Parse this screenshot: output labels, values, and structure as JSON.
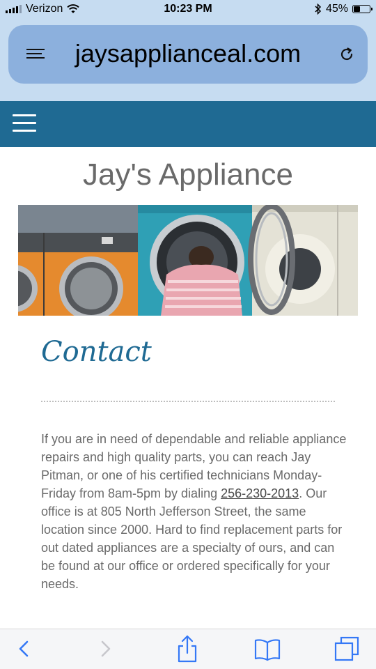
{
  "status_bar": {
    "carrier": "Verizon",
    "time": "10:23 PM",
    "battery_percent": "45%",
    "battery_level": 0.45
  },
  "browser": {
    "url": "jaysapplianceal.com",
    "reader_icon": "reader-lines-icon",
    "reload_icon": "reload-icon"
  },
  "site": {
    "nav_icon": "hamburger-menu-icon",
    "title": "Jay's Appliance",
    "banner_image": "laundromat washers banner",
    "heading": "Contact",
    "body_part1": "If you are in need of dependable and reliable appliance repairs and high quality parts, you can reach Jay Pitman, or one of his certified technicians Monday-Friday from 8am-5pm by dialing ",
    "phone": "256-230-2013",
    "body_part2": ". Our office is at 805 North Jefferson Street, the same location since 2000. Hard to find replacement parts for out dated appliances are a specialty of ours, and can be found at our office or ordered specifically for your needs."
  },
  "toolbar": {
    "back_icon": "back-chevron-icon",
    "forward_icon": "forward-chevron-icon",
    "share_icon": "share-icon",
    "bookmarks_icon": "bookmarks-book-icon",
    "tabs_icon": "tabs-icon"
  },
  "colors": {
    "chrome_bg": "#c6dcf1",
    "address_bg": "#8cb0dd",
    "nav_bg": "#1f6a93",
    "heading": "#1f6a93",
    "text": "#6a6a6a",
    "ios_blue": "#3478f6"
  }
}
